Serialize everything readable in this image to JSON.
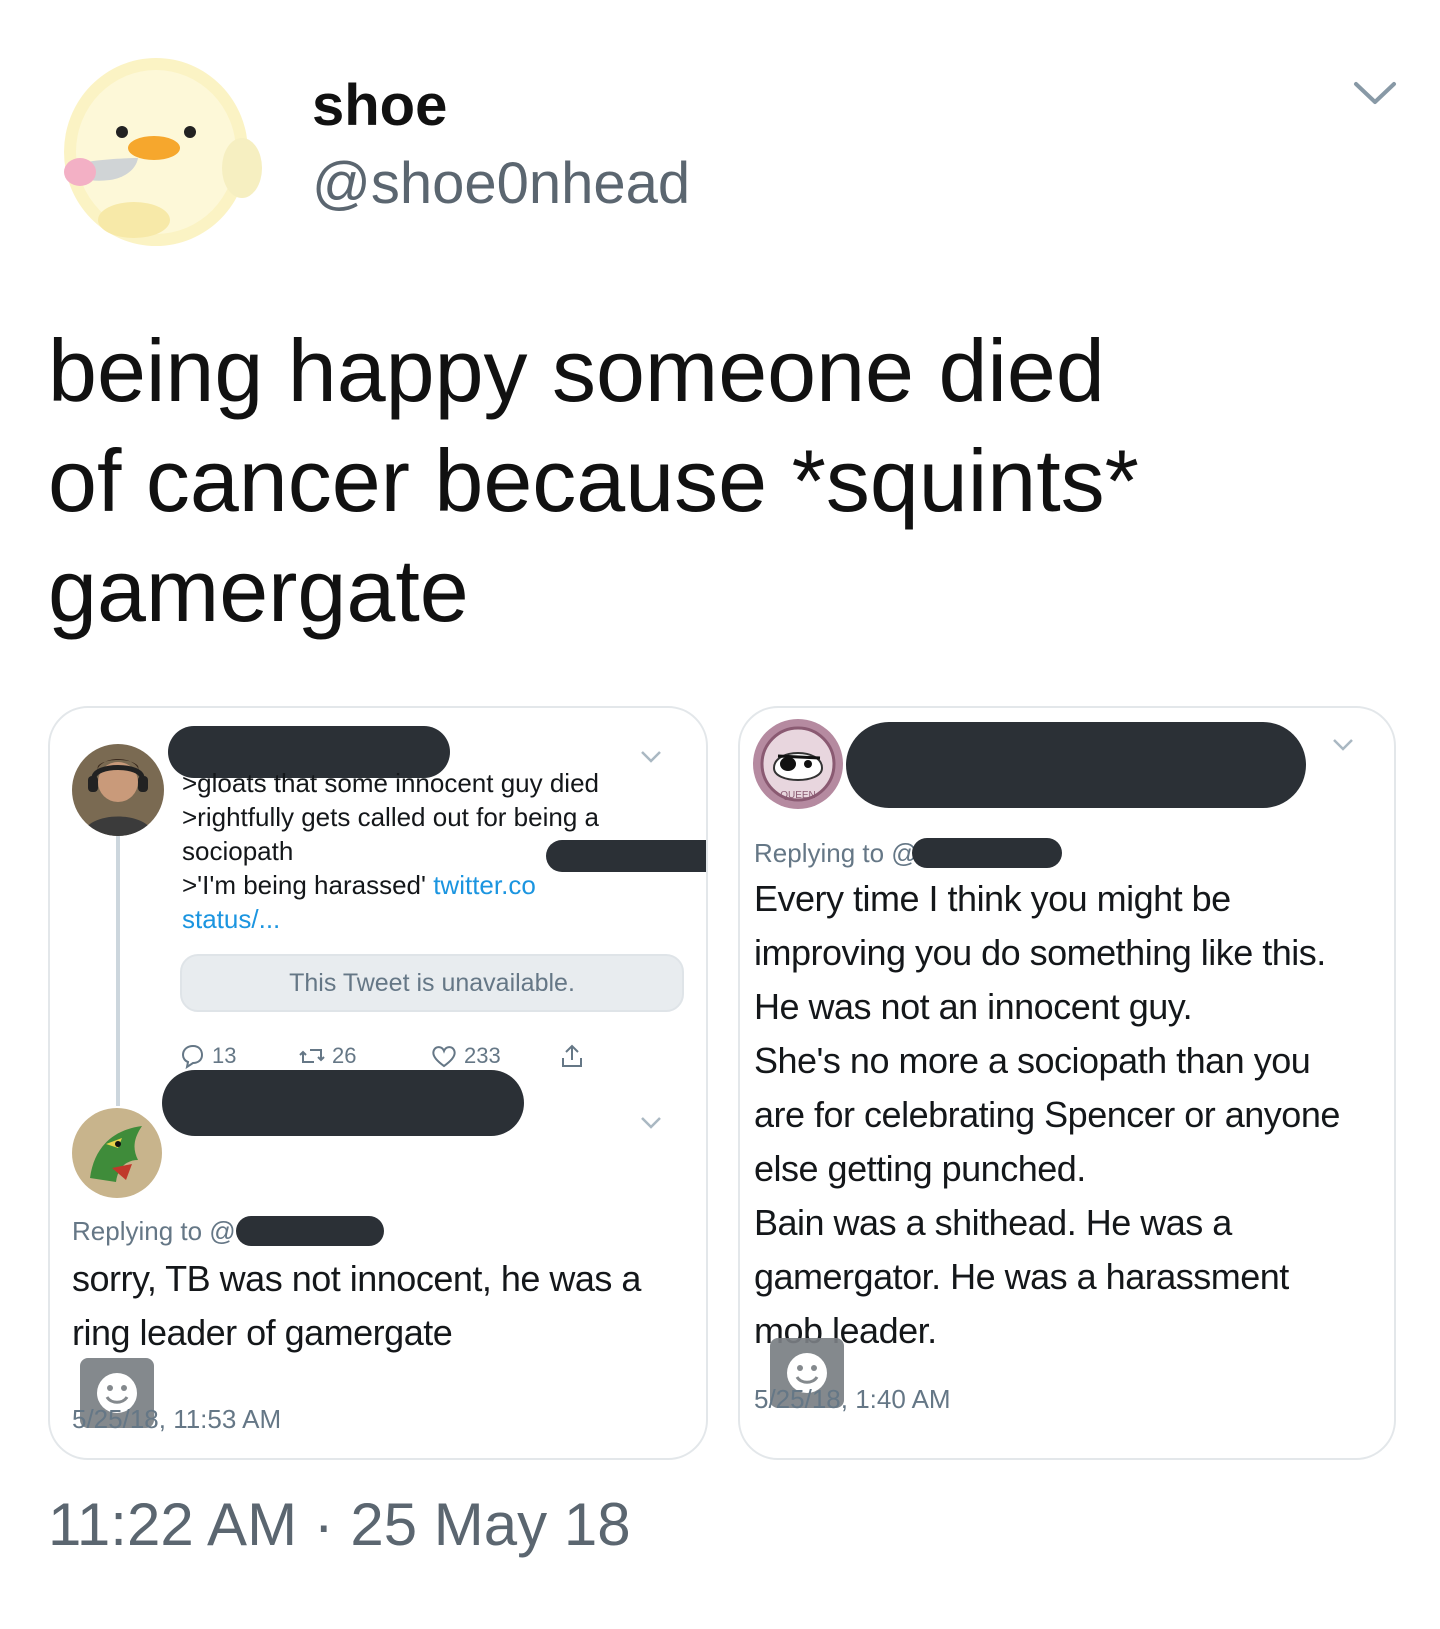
{
  "author": {
    "display_name": "shoe",
    "handle": "@shoe0nhead",
    "avatar_icon": "chick-with-knife-icon"
  },
  "tweet": {
    "lines": [
      "being happy someone died",
      "of cancer because *squints*",
      "gamergate"
    ],
    "timestamp": "11:22 AM",
    "separator": "·",
    "date": "25 May 18"
  },
  "left_panel": {
    "quoted_tweet": {
      "lines": [
        ">gloats that some innocent guy died",
        ">rightfully gets called out for being a",
        "sociopath"
      ],
      "line4_prefix": ">'I'm being harassed' ",
      "link_part1": "twitter.co",
      "link_part2": "status/...",
      "unavailable_notice": "This Tweet is unavailable.",
      "stats": {
        "replies": "13",
        "retweets": "26",
        "likes": "233"
      }
    },
    "reply": {
      "replying_to": "Replying to @",
      "text_lines": [
        "sorry, TB was not innocent, he was a",
        "ring leader of gamergate"
      ],
      "date": "5/25/18, 11:53 AM"
    }
  },
  "right_panel": {
    "avatar_badge_text": "QUEEN",
    "reply": {
      "replying_to": "Replying to @",
      "text_lines": [
        "Every time I think you might be",
        "improving you do something like this.",
        "He was not an innocent guy.",
        "She's no more a sociopath than you",
        "are for celebrating Spencer or anyone",
        "else getting punched.",
        "Bain was a shithead. He was a",
        "gamergator. He was a harassment",
        "mob leader."
      ],
      "date": "5/25/18, 1:40 AM"
    }
  },
  "colors": {
    "link": "#1b95e0",
    "muted": "#657786",
    "redaction": "#2b3036"
  }
}
